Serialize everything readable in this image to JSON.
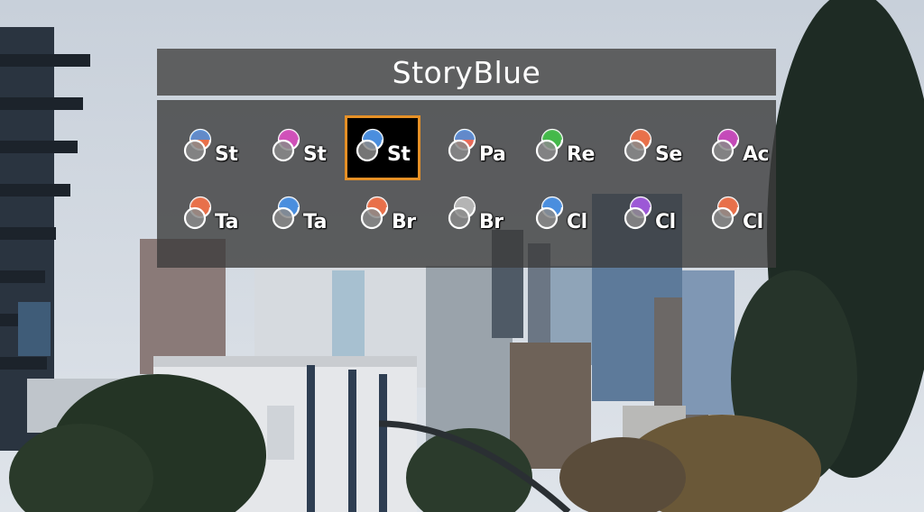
{
  "header": {
    "title": "StoryBlue"
  },
  "selected_index": 2,
  "items": [
    {
      "abbr": "St",
      "colors": [
        "#e8704a",
        "#4a8ede"
      ]
    },
    {
      "abbr": "St",
      "colors": [
        "#d050b8",
        "#d050b8"
      ]
    },
    {
      "abbr": "St",
      "colors": [
        "#4a8ede",
        "#4a8ede"
      ]
    },
    {
      "abbr": "Pa",
      "colors": [
        "#e86b5a",
        "#4a8ede"
      ]
    },
    {
      "abbr": "Re",
      "colors": [
        "#44b84a",
        "#44b84a"
      ]
    },
    {
      "abbr": "Se",
      "colors": [
        "#e8704a",
        "#e8704a"
      ]
    },
    {
      "abbr": "Ac",
      "colors": [
        "#c44ab8",
        "#c44ab8"
      ]
    },
    {
      "abbr": "Ta",
      "colors": [
        "#e8704a",
        "#e8704a"
      ]
    },
    {
      "abbr": "Ta",
      "colors": [
        "#4a8ede",
        "#4a8ede"
      ]
    },
    {
      "abbr": "Br",
      "colors": [
        "#e8704a",
        "#e8704a"
      ]
    },
    {
      "abbr": "Br",
      "colors": [
        "#b4b4b4",
        "#b4b4b4"
      ]
    },
    {
      "abbr": "Cl",
      "colors": [
        "#4a8ede",
        "#4a8ede"
      ]
    },
    {
      "abbr": "Cl",
      "colors": [
        "#9c58d6",
        "#9c58d6"
      ]
    },
    {
      "abbr": "Cl",
      "colors": [
        "#e8704a",
        "#e8704a"
      ]
    }
  ]
}
